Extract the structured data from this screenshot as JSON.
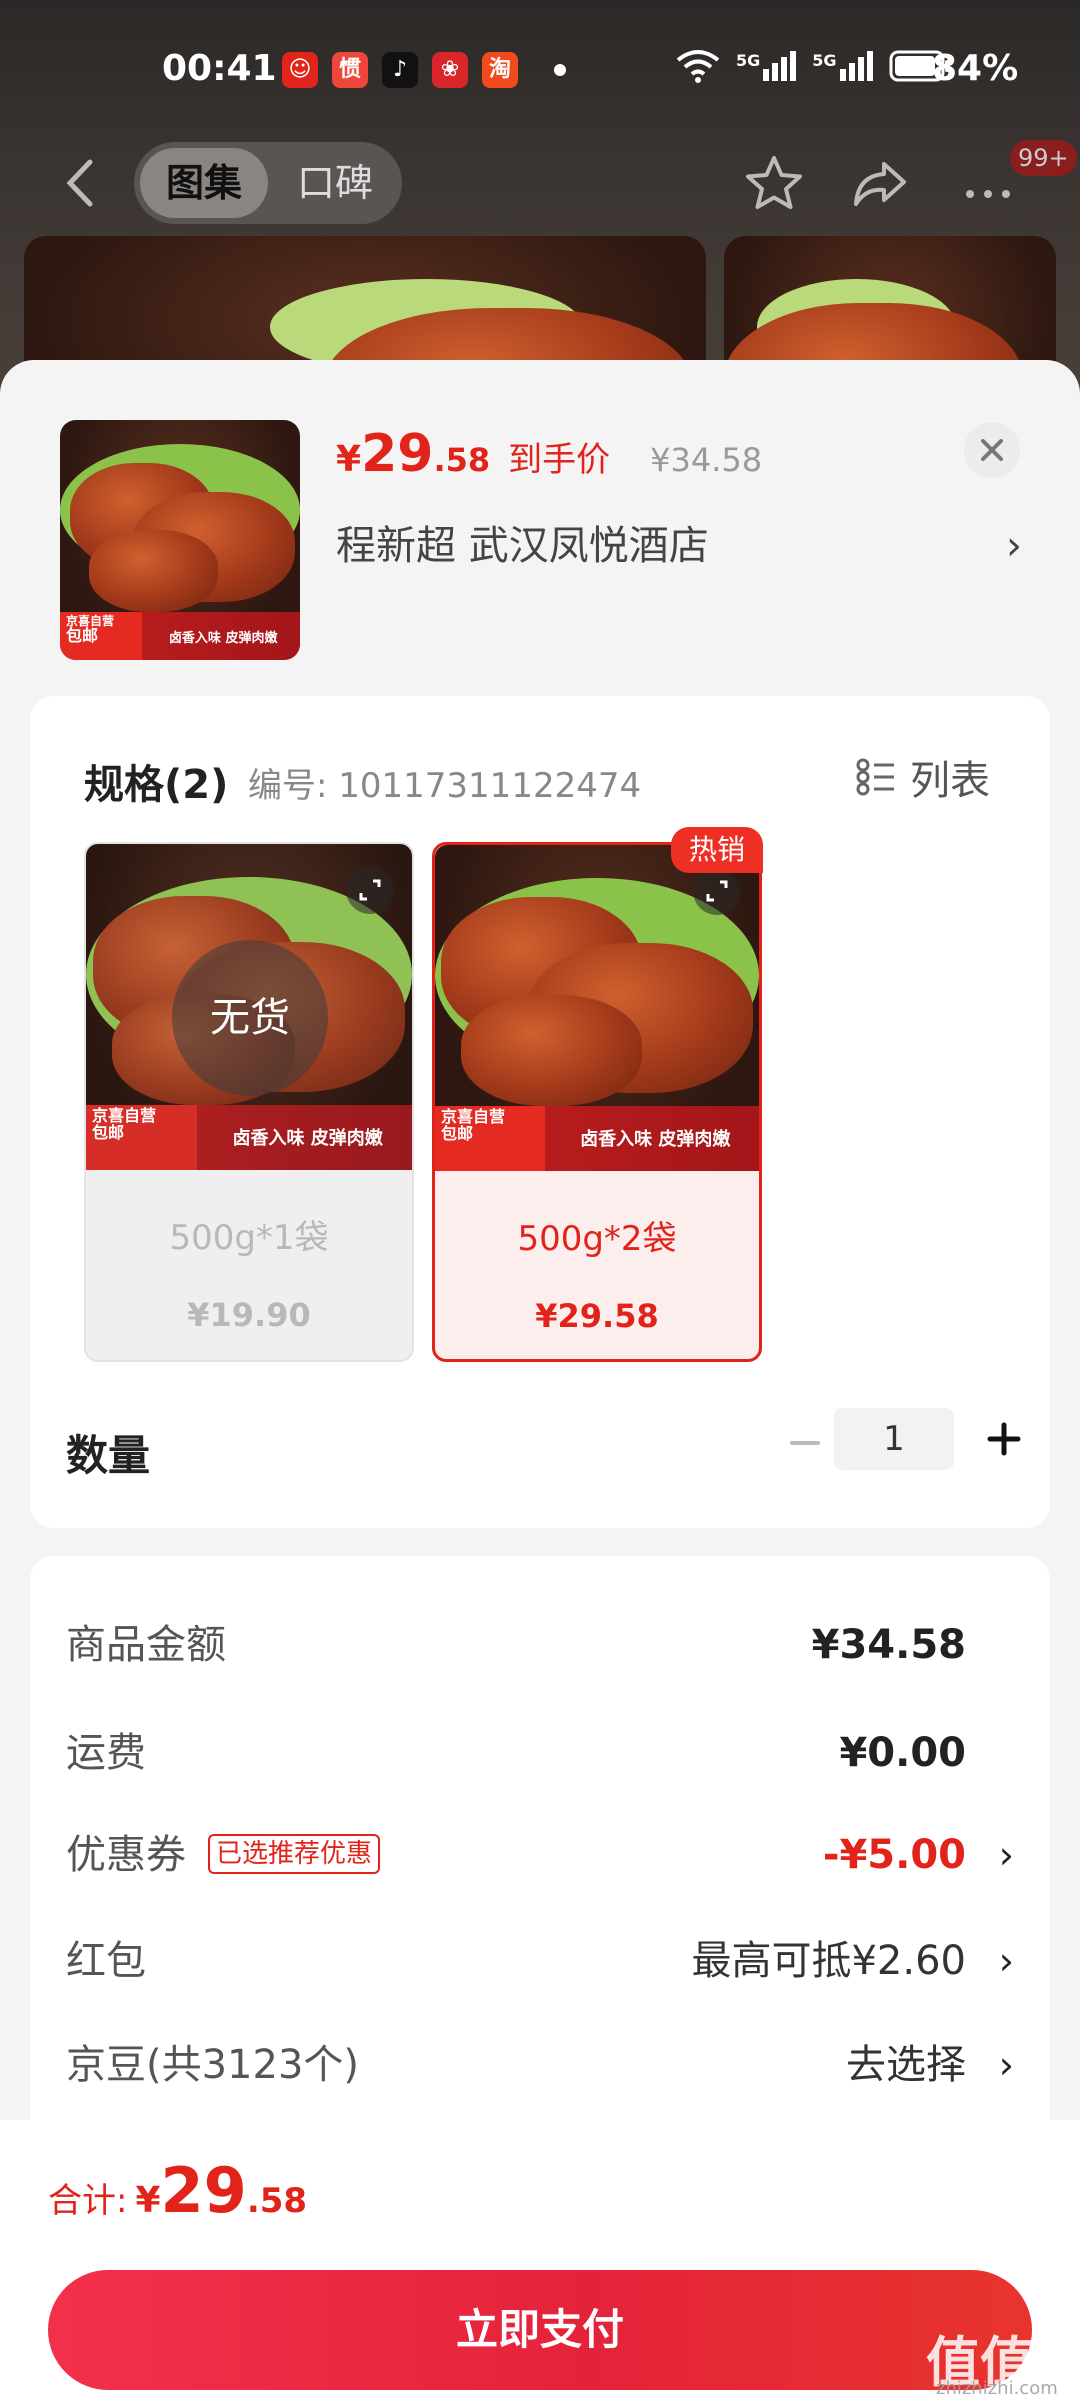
{
  "status_bar": {
    "time": "00:41",
    "network_1": "5G",
    "network_2": "5G",
    "battery": "84%"
  },
  "nav": {
    "tab_gallery": "图集",
    "tab_reviews": "口碑",
    "more_badge": "99+"
  },
  "product": {
    "price_symbol": "¥",
    "price_int": "29",
    "price_dec": ".58",
    "price_tag": "到手价",
    "original_price": "¥34.58",
    "store": "程新超  武汉凤悦酒店",
    "store_arrow": "›",
    "image_tag_line1": "京喜自营",
    "image_tag_line2": "包邮",
    "image_slogan": "卤香入味 皮弹肉嫩"
  },
  "spec": {
    "title": "规格(2)",
    "code": "编号: 10117311122474",
    "list_label": "列表",
    "skus": [
      {
        "name": "500g*1袋",
        "price": "¥19.90",
        "stock": "无货"
      },
      {
        "name": "500g*2袋",
        "price": "¥29.58",
        "badge": "热销"
      }
    ]
  },
  "quantity": {
    "label": "数量",
    "value": "1"
  },
  "summary": {
    "goods_amount": {
      "label": "商品金额",
      "value": "¥34.58"
    },
    "shipping": {
      "label": "运费",
      "value": "¥0.00"
    },
    "coupon": {
      "label": "优惠券",
      "tag": "已选推荐优惠",
      "value": "-¥5.00"
    },
    "red_packet": {
      "label": "红包",
      "value": "最高可抵¥2.60"
    },
    "jd_beans": {
      "label": "京豆(共3123个)",
      "value": "去选择"
    },
    "arrow": "›"
  },
  "footer": {
    "total_label": "合计:",
    "total_symbol": "¥",
    "total_int": "29",
    "total_dec": ".58",
    "pay_button": "立即支付"
  },
  "watermark": {
    "main": "值值值",
    "sub": "zhizhizhi.com"
  },
  "colors": {
    "accent": "#e2231a",
    "pay_button": "#e4233a",
    "hot_badge": "#ee2f24"
  }
}
